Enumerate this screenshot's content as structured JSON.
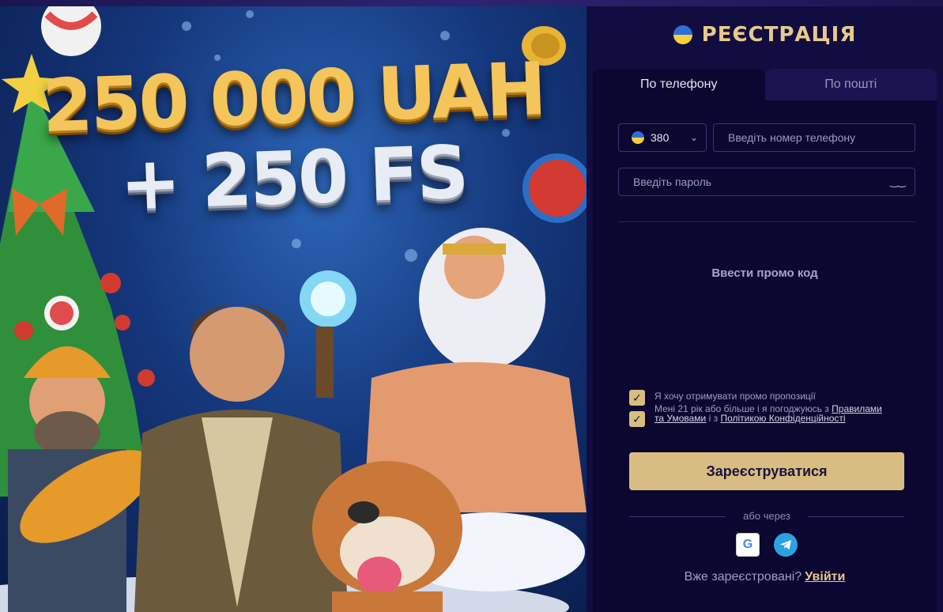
{
  "promo": {
    "headline_line1": "250 000 UAH",
    "headline_line2": "+ 250 FS"
  },
  "registration": {
    "title": "РЕЄСТРАЦІЯ",
    "tabs": [
      {
        "label": "По телефону",
        "active": true
      },
      {
        "label": "По пошті",
        "active": false
      }
    ],
    "country_code": "380",
    "phone_placeholder": "Введіть номер телефону",
    "password_placeholder": "Введіть пароль",
    "promo_code_label": "Ввести промо код",
    "consent_promo": "Я хочу отримувати промо пропозиції",
    "consent_terms_prefix": "Мені 21 рік або більше і я погоджуюсь з",
    "consent_terms_link": "Правилами та Умовами",
    "consent_terms_mid": "і з",
    "consent_privacy_link": "Політикою Конфіденційності",
    "submit_label": "Зареєструватися",
    "or_text": "або через",
    "social": [
      "google-icon",
      "telegram-icon"
    ],
    "already_registered": "Вже зареєстровані?",
    "login_link": "Увійти"
  },
  "colors": {
    "accent_gold": "#d8bd82",
    "panel_bg": "#0b0730",
    "title_gold": "#e8c98c"
  }
}
